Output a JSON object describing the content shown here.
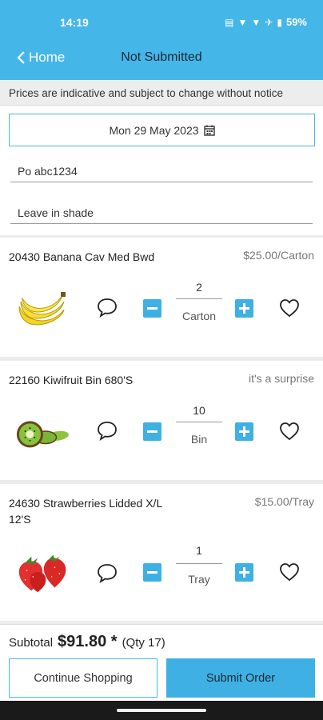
{
  "status_bar": {
    "time": "14:19",
    "battery": "59%"
  },
  "nav": {
    "back_label": "Home",
    "title": "Not Submitted"
  },
  "notice": "Prices are indicative and subject to change without notice",
  "form": {
    "date": "Mon 29 May 2023",
    "po": "Po abc1234",
    "note": "Leave in shade"
  },
  "products": [
    {
      "name": "20430 Banana Cav Med Bwd",
      "price": "$25.00/Carton",
      "qty": "2",
      "unit": "Carton",
      "image": "banana-image"
    },
    {
      "name": "22160 Kiwifruit Bin 680'S",
      "price": "it's a surprise",
      "qty": "10",
      "unit": "Bin",
      "image": "kiwifruit-image"
    },
    {
      "name_line1": "24630 Strawberries Lidded X/L",
      "name_line2": "12'S",
      "price": "$15.00/Tray",
      "qty": "1",
      "unit": "Tray",
      "image": "strawberries-image"
    }
  ],
  "footer": {
    "subtotal_label": "Subtotal",
    "subtotal_amount": "$91.80 *",
    "qty_text": "(Qty 17)",
    "continue_label": "Continue Shopping",
    "submit_label": "Submit Order"
  },
  "colors": {
    "accent": "#45b6e8",
    "button": "#3fb0e4"
  },
  "icons": [
    "chevron-left-icon",
    "calendar-icon",
    "comment-icon",
    "minus-icon",
    "plus-icon",
    "heart-icon",
    "wifi-icon",
    "airplane-icon",
    "battery-icon"
  ]
}
